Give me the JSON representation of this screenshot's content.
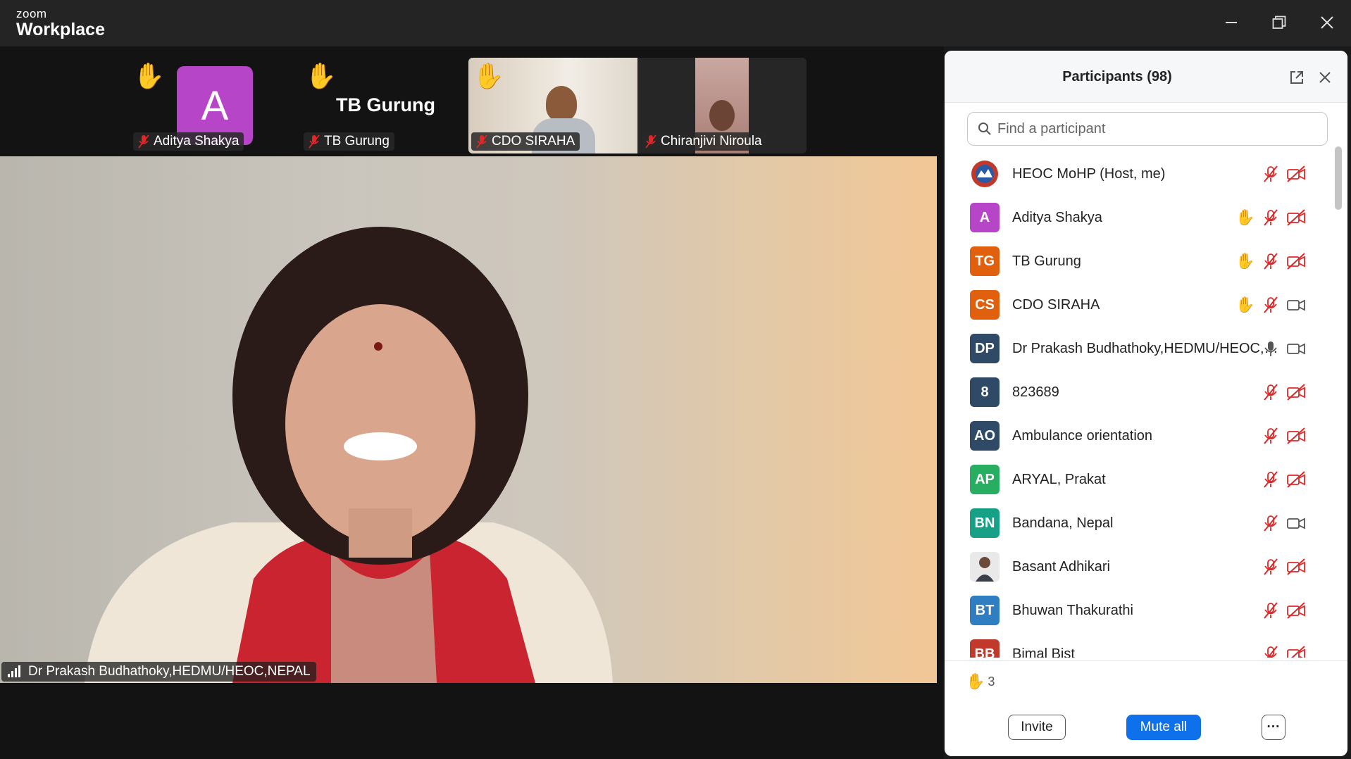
{
  "app": {
    "brand_small": "zoom",
    "brand_big": "Workplace"
  },
  "window_controls": [
    "minimize-icon",
    "restore-icon",
    "close-icon"
  ],
  "top_strip": [
    {
      "name": "Aditya Shakya",
      "hand_raised": true,
      "muted": true,
      "avatar_letter": "A",
      "avatar_color": "#b645c8",
      "video": false
    },
    {
      "name": "TB Gurung",
      "hand_raised": true,
      "muted": true,
      "display_text": "TB Gurung",
      "video": false
    },
    {
      "name": "CDO SIRAHA",
      "hand_raised": true,
      "muted": true,
      "video": true
    },
    {
      "name": "Chiranjivi Niroula",
      "hand_raised": false,
      "muted": true,
      "video": true
    }
  ],
  "main_speaker": {
    "label": "Dr Prakash Budhathoky,HEDMU/HEOC,NEPAL"
  },
  "participants_panel": {
    "title": "Participants (98)",
    "search_placeholder": "Find a participant",
    "participants": [
      {
        "name": "HEOC MoHP (Host, me)",
        "initials": "",
        "color": "#c0392b",
        "avatar_type": "logo",
        "hand": false,
        "mic": "muted",
        "video": "off"
      },
      {
        "name": "Aditya Shakya",
        "initials": "A",
        "color": "#b645c8",
        "hand": true,
        "mic": "muted",
        "video": "off"
      },
      {
        "name": "TB Gurung",
        "initials": "TG",
        "color": "#e0600e",
        "hand": true,
        "mic": "muted",
        "video": "off"
      },
      {
        "name": "CDO SIRAHA",
        "initials": "CS",
        "color": "#e0600e",
        "hand": true,
        "mic": "muted",
        "video": "on"
      },
      {
        "name": "Dr Prakash Budhathoky,HEDMU/HEOC,N...",
        "initials": "DP",
        "color": "#2f4a66",
        "hand": false,
        "mic": "on",
        "video": "on"
      },
      {
        "name": "823689",
        "initials": "8",
        "color": "#2f4a66",
        "hand": false,
        "mic": "muted",
        "video": "off"
      },
      {
        "name": "Ambulance orientation",
        "initials": "AO",
        "color": "#2f4a66",
        "hand": false,
        "mic": "muted",
        "video": "off"
      },
      {
        "name": "ARYAL, Prakat",
        "initials": "AP",
        "color": "#27ae60",
        "hand": false,
        "mic": "muted",
        "video": "off"
      },
      {
        "name": "Bandana, Nepal",
        "initials": "BN",
        "color": "#16a085",
        "hand": false,
        "mic": "muted",
        "video": "on"
      },
      {
        "name": "Basant Adhikari",
        "initials": "",
        "color": "#d9d9d9",
        "avatar_type": "photo",
        "hand": false,
        "mic": "muted",
        "video": "off"
      },
      {
        "name": "Bhuwan Thakurathi",
        "initials": "BT",
        "color": "#2f7ec2",
        "hand": false,
        "mic": "muted",
        "video": "off"
      },
      {
        "name": "Bimal Bist",
        "initials": "BB",
        "color": "#c0392b",
        "hand": false,
        "mic": "muted",
        "video": "off"
      }
    ],
    "raised_hands_count": "3",
    "invite_label": "Invite",
    "mute_all_label": "Mute all",
    "more_label": "···"
  },
  "colors": {
    "accent": "#0e71eb",
    "muted_red": "#e02828",
    "hand_yellow": "#f5b400"
  }
}
